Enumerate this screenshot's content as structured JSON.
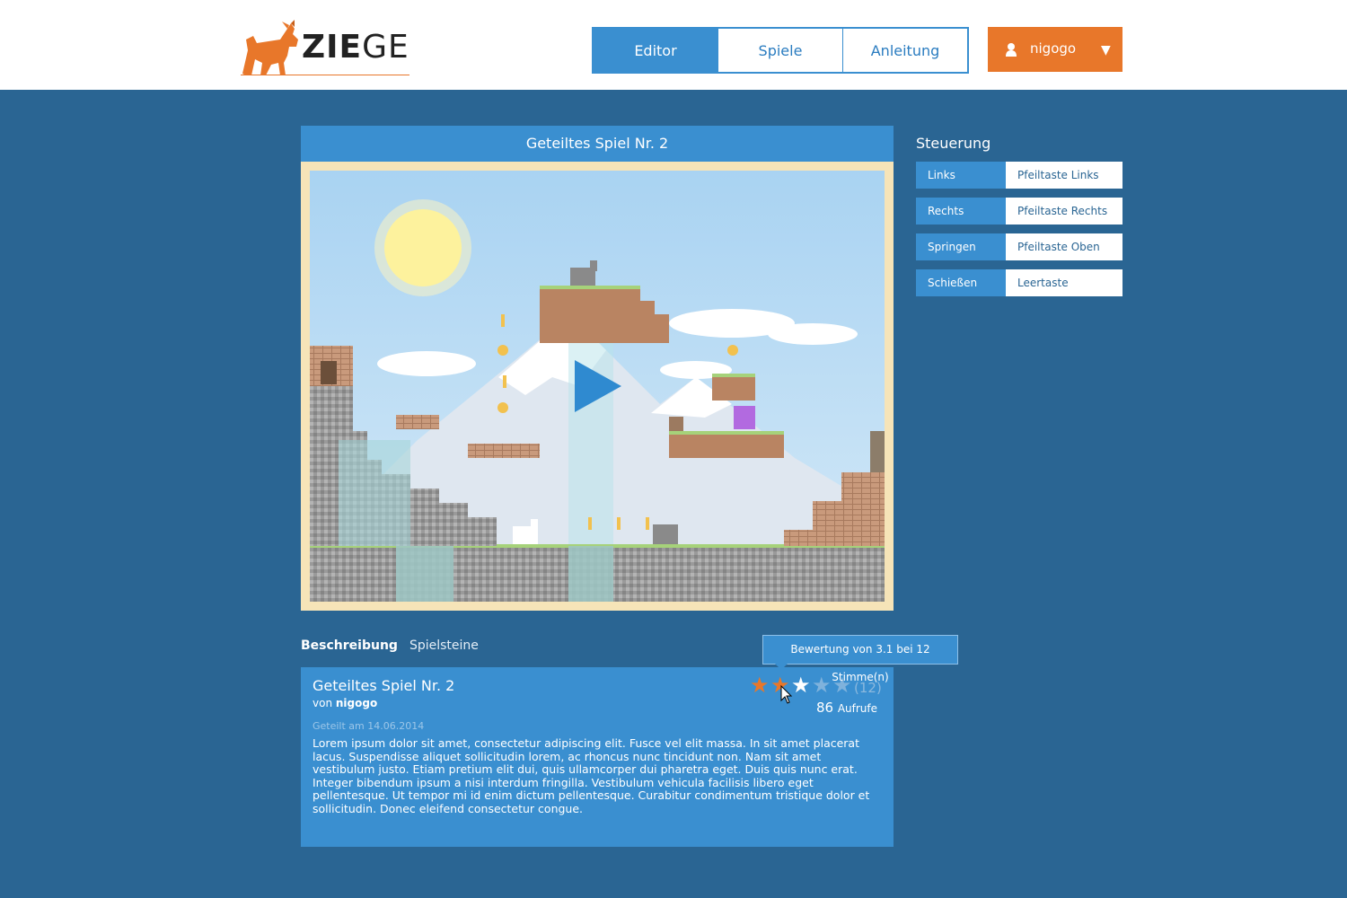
{
  "brand": {
    "logo_text_bold": "ZIE",
    "logo_text_rest": "GE",
    "accent": "#e8772a",
    "primary": "#3a8fd0",
    "background": "#2a6593"
  },
  "nav": {
    "tabs": [
      {
        "label": "Editor",
        "active": true
      },
      {
        "label": "Spiele",
        "active": false
      },
      {
        "label": "Anleitung",
        "active": false
      }
    ]
  },
  "user": {
    "name": "nigogo",
    "icon": "user-icon",
    "caret": "▼"
  },
  "game": {
    "title": "Geteiltes Spiel Nr. 2",
    "play_icon": "play-icon"
  },
  "controls": {
    "title": "Steuerung",
    "rows": [
      {
        "action": "Links",
        "key": "Pfeiltaste Links"
      },
      {
        "action": "Rechts",
        "key": "Pfeiltaste Rechts"
      },
      {
        "action": "Springen",
        "key": "Pfeiltaste Oben"
      },
      {
        "action": "Schießen",
        "key": "Leertaste"
      }
    ]
  },
  "tabs": {
    "description": "Beschreibung",
    "tiles": "Spielsteine"
  },
  "description": {
    "title": "Geteiltes Spiel Nr. 2",
    "author_prefix": "von",
    "author": "nigogo",
    "shared": "Geteilt am 14.06.2014",
    "body": "Lorem ipsum dolor sit amet, consectetur adipiscing elit. Fusce vel elit massa. In sit amet placerat lacus. Suspendisse aliquet sollicitudin lorem, ac rhoncus nunc tincidunt non. Nam sit amet vestibulum justo. Etiam pretium elit dui, quis ullamcorper dui pharetra eget. Duis quis nunc erat. Integer bibendum ipsum a nisi interdum fringilla. Vestibulum vehicula facilisis libero eget pellentesque. Ut tempor mi id enim dictum pellentesque. Curabitur condimentum tristique dolor et sollicitudin. Donec eleifend consectetur congue.",
    "rating_stars": 5,
    "rating_filled": 2,
    "rating_hover": 3,
    "rating_count": "(12)",
    "views_number": "86",
    "views_label": "Aufrufe"
  },
  "tooltip": "Bewertung von 3.1 bei 12 Stimme(n)"
}
